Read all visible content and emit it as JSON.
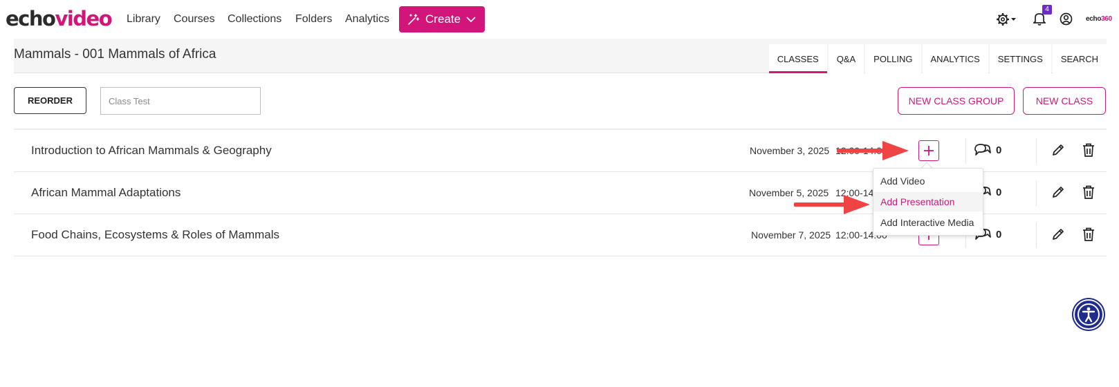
{
  "app": {
    "logo_part1": "echo",
    "logo_part2": "video"
  },
  "nav": {
    "links": [
      "Library",
      "Courses",
      "Collections",
      "Folders",
      "Analytics"
    ],
    "create_label": "Create",
    "notifications_count": "4",
    "brand": {
      "part1": "echo",
      "part2": "360"
    }
  },
  "course": {
    "title": "Mammals - 001 Mammals of Africa",
    "tabs": [
      "CLASSES",
      "Q&A",
      "POLLING",
      "ANALYTICS",
      "SETTINGS",
      "SEARCH"
    ],
    "active_tab": "CLASSES"
  },
  "toolbar": {
    "reorder_label": "REORDER",
    "search_value": "",
    "search_placeholder": "Class Test",
    "new_class_group_label": "NEW CLASS GROUP",
    "new_class_label": "NEW CLASS"
  },
  "classes": [
    {
      "title": "Introduction to African Mammals & Geography",
      "date": "November 3, 2025",
      "time": "12:00-14:00",
      "comments": "0"
    },
    {
      "title": "African Mammal Adaptations",
      "date": "November 5, 2025",
      "time": "12:00-14:00",
      "comments": "0"
    },
    {
      "title": "Food Chains, Ecosystems & Roles of Mammals",
      "date": "November 7, 2025",
      "time": "12:00-14:00",
      "comments": "0"
    }
  ],
  "add_menu": {
    "items": [
      "Add Video",
      "Add Presentation",
      "Add Interactive Media"
    ],
    "highlighted": "Add Presentation"
  },
  "colors": {
    "brand": "#d1157a",
    "badge": "#6b2cc9",
    "annotation_arrow": "#f04444",
    "accessibility": "#1f2b8f"
  },
  "icons": [
    "magic-wand-icon",
    "chevron-down-icon",
    "gear-icon",
    "bell-icon",
    "user-icon",
    "plus-icon",
    "comments-icon",
    "pencil-icon",
    "trash-icon",
    "accessibility-icon"
  ]
}
